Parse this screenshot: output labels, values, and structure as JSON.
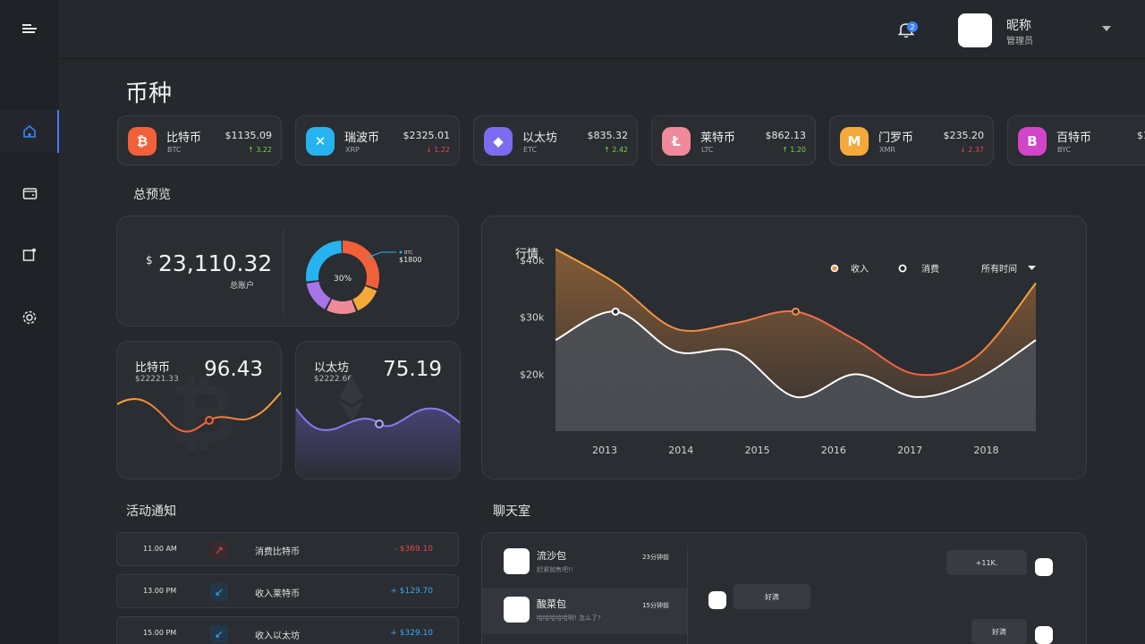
{
  "topbar": {
    "notification_count": "2",
    "user_name": "昵称",
    "user_role": "管理员"
  },
  "page": {
    "title": "币种"
  },
  "coins": [
    {
      "name": "比特币",
      "symbol": "BTC",
      "price": "$1135.09",
      "change": "3.22",
      "direction": "up",
      "color": "#f2603a",
      "glyph": "₿"
    },
    {
      "name": "瑞波币",
      "symbol": "XRP",
      "price": "$2325.01",
      "change": "1.22",
      "direction": "down",
      "color": "#27b3f0",
      "glyph": "✕"
    },
    {
      "name": "以太坊",
      "symbol": "ETC",
      "price": "$835.32",
      "change": "2.42",
      "direction": "up",
      "color": "#7b6cf0",
      "glyph": "◆"
    },
    {
      "name": "莱特币",
      "symbol": "LTC",
      "price": "$862.13",
      "change": "1.20",
      "direction": "up",
      "color": "#f08a9a",
      "glyph": "Ł"
    },
    {
      "name": "门罗币",
      "symbol": "XMR",
      "price": "$235.20",
      "change": "2.37",
      "direction": "down",
      "color": "#f5a93b",
      "glyph": "M"
    },
    {
      "name": "百特币",
      "symbol": "BYC",
      "price": "$196",
      "change": "",
      "direction": "up",
      "color": "#d245c9",
      "glyph": "B"
    }
  ],
  "overview": {
    "heading": "总预览",
    "currency": "$",
    "total": "23,110.32",
    "total_label": "总账户",
    "donut_center": "30%",
    "donut_legend_name": "BTC",
    "donut_legend_value": "$1800"
  },
  "mini_cards": [
    {
      "name": "比特币",
      "sub": "$22221.33",
      "value": "96.43"
    },
    {
      "name": "以太坊",
      "sub": "$2222.66",
      "value": "75.19"
    }
  ],
  "market": {
    "title": "行情",
    "legend_income": "收入",
    "legend_spend": "消费",
    "filter": "所有时间"
  },
  "chart_data": {
    "type": "area",
    "title": "行情",
    "x": [
      "2013",
      "2014",
      "2015",
      "2016",
      "2017",
      "2018"
    ],
    "y_ticks": [
      "$40k",
      "$30k",
      "$20k"
    ],
    "ylim": [
      10,
      43
    ],
    "series": [
      {
        "name": "收入",
        "color": "#f0923b",
        "values": [
          42,
          36,
          28,
          29,
          31,
          26,
          20,
          23,
          36
        ]
      },
      {
        "name": "消费",
        "color": "#ffffff",
        "values": [
          26,
          31,
          24,
          24,
          16,
          20,
          16,
          19,
          26
        ]
      }
    ],
    "legend": "top-right",
    "grid": false
  },
  "activities": {
    "heading": "活动通知",
    "rows": [
      {
        "time": "11.00 AM",
        "text": "消费比特币",
        "amount": "- $369.10",
        "type": "out"
      },
      {
        "time": "13.00 PM",
        "text": "收入莱特币",
        "amount": "+ $129.70",
        "type": "in"
      },
      {
        "time": "15.00 PM",
        "text": "收入以太坊",
        "amount": "+ $329.10",
        "type": "in"
      }
    ]
  },
  "chat": {
    "heading": "聊天室",
    "contacts": [
      {
        "name": "流沙包",
        "msg": "赶紧抛售吧!!",
        "time": "23分钟前"
      },
      {
        "name": "酸菜包",
        "msg": "哈哈哈哈哈啊! 怎么了?",
        "time": "15分钟前"
      }
    ],
    "messages": [
      "+11K.",
      "好滴",
      "好滴"
    ]
  }
}
